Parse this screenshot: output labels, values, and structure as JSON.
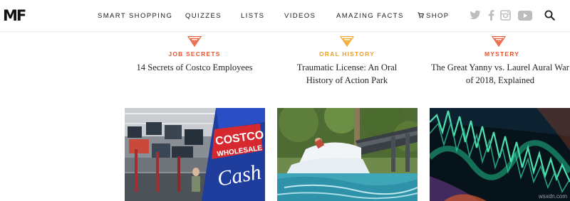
{
  "logo": {
    "text": "MF"
  },
  "nav": {
    "items": [
      {
        "label": "SMART SHOPPING"
      },
      {
        "label": "QUIZZES"
      },
      {
        "label": "LISTS"
      },
      {
        "label": "VIDEOS"
      },
      {
        "label": "AMAZING FACTS"
      },
      {
        "label": "SHOP",
        "icon": "cart-icon"
      }
    ]
  },
  "social": [
    "twitter-icon",
    "facebook-icon",
    "instagram-icon",
    "youtube-icon"
  ],
  "articles": [
    {
      "category": "JOB SECRETS",
      "color": "#e8532b",
      "title": "14 Secrets of Costco Employees"
    },
    {
      "category": "ORAL HISTORY",
      "color": "#f0a020",
      "title": "Traumatic License: An Oral History of Action Park"
    },
    {
      "category": "MYSTERY",
      "color": "#e8532b",
      "title": "The Great Yanny vs. Laurel Aural War of 2018, Explained"
    }
  ],
  "images": [
    {
      "sign_top": "COSTCO",
      "sign_mid": "WHOLESALE",
      "sign_bottom": "Cash"
    }
  ],
  "watermark": "wsxdn.com"
}
